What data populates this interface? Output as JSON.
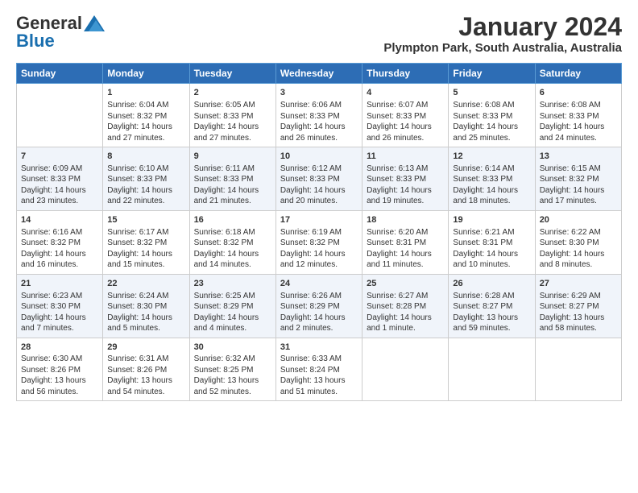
{
  "logo": {
    "general": "General",
    "blue": "Blue"
  },
  "title": "January 2024",
  "subtitle": "Plympton Park, South Australia, Australia",
  "days_of_week": [
    "Sunday",
    "Monday",
    "Tuesday",
    "Wednesday",
    "Thursday",
    "Friday",
    "Saturday"
  ],
  "weeks": [
    [
      {
        "day": "",
        "info": ""
      },
      {
        "day": "1",
        "info": "Sunrise: 6:04 AM\nSunset: 8:32 PM\nDaylight: 14 hours\nand 27 minutes."
      },
      {
        "day": "2",
        "info": "Sunrise: 6:05 AM\nSunset: 8:33 PM\nDaylight: 14 hours\nand 27 minutes."
      },
      {
        "day": "3",
        "info": "Sunrise: 6:06 AM\nSunset: 8:33 PM\nDaylight: 14 hours\nand 26 minutes."
      },
      {
        "day": "4",
        "info": "Sunrise: 6:07 AM\nSunset: 8:33 PM\nDaylight: 14 hours\nand 26 minutes."
      },
      {
        "day": "5",
        "info": "Sunrise: 6:08 AM\nSunset: 8:33 PM\nDaylight: 14 hours\nand 25 minutes."
      },
      {
        "day": "6",
        "info": "Sunrise: 6:08 AM\nSunset: 8:33 PM\nDaylight: 14 hours\nand 24 minutes."
      }
    ],
    [
      {
        "day": "7",
        "info": "Sunrise: 6:09 AM\nSunset: 8:33 PM\nDaylight: 14 hours\nand 23 minutes."
      },
      {
        "day": "8",
        "info": "Sunrise: 6:10 AM\nSunset: 8:33 PM\nDaylight: 14 hours\nand 22 minutes."
      },
      {
        "day": "9",
        "info": "Sunrise: 6:11 AM\nSunset: 8:33 PM\nDaylight: 14 hours\nand 21 minutes."
      },
      {
        "day": "10",
        "info": "Sunrise: 6:12 AM\nSunset: 8:33 PM\nDaylight: 14 hours\nand 20 minutes."
      },
      {
        "day": "11",
        "info": "Sunrise: 6:13 AM\nSunset: 8:33 PM\nDaylight: 14 hours\nand 19 minutes."
      },
      {
        "day": "12",
        "info": "Sunrise: 6:14 AM\nSunset: 8:33 PM\nDaylight: 14 hours\nand 18 minutes."
      },
      {
        "day": "13",
        "info": "Sunrise: 6:15 AM\nSunset: 8:32 PM\nDaylight: 14 hours\nand 17 minutes."
      }
    ],
    [
      {
        "day": "14",
        "info": "Sunrise: 6:16 AM\nSunset: 8:32 PM\nDaylight: 14 hours\nand 16 minutes."
      },
      {
        "day": "15",
        "info": "Sunrise: 6:17 AM\nSunset: 8:32 PM\nDaylight: 14 hours\nand 15 minutes."
      },
      {
        "day": "16",
        "info": "Sunrise: 6:18 AM\nSunset: 8:32 PM\nDaylight: 14 hours\nand 14 minutes."
      },
      {
        "day": "17",
        "info": "Sunrise: 6:19 AM\nSunset: 8:32 PM\nDaylight: 14 hours\nand 12 minutes."
      },
      {
        "day": "18",
        "info": "Sunrise: 6:20 AM\nSunset: 8:31 PM\nDaylight: 14 hours\nand 11 minutes."
      },
      {
        "day": "19",
        "info": "Sunrise: 6:21 AM\nSunset: 8:31 PM\nDaylight: 14 hours\nand 10 minutes."
      },
      {
        "day": "20",
        "info": "Sunrise: 6:22 AM\nSunset: 8:30 PM\nDaylight: 14 hours\nand 8 minutes."
      }
    ],
    [
      {
        "day": "21",
        "info": "Sunrise: 6:23 AM\nSunset: 8:30 PM\nDaylight: 14 hours\nand 7 minutes."
      },
      {
        "day": "22",
        "info": "Sunrise: 6:24 AM\nSunset: 8:30 PM\nDaylight: 14 hours\nand 5 minutes."
      },
      {
        "day": "23",
        "info": "Sunrise: 6:25 AM\nSunset: 8:29 PM\nDaylight: 14 hours\nand 4 minutes."
      },
      {
        "day": "24",
        "info": "Sunrise: 6:26 AM\nSunset: 8:29 PM\nDaylight: 14 hours\nand 2 minutes."
      },
      {
        "day": "25",
        "info": "Sunrise: 6:27 AM\nSunset: 8:28 PM\nDaylight: 14 hours\nand 1 minute."
      },
      {
        "day": "26",
        "info": "Sunrise: 6:28 AM\nSunset: 8:27 PM\nDaylight: 13 hours\nand 59 minutes."
      },
      {
        "day": "27",
        "info": "Sunrise: 6:29 AM\nSunset: 8:27 PM\nDaylight: 13 hours\nand 58 minutes."
      }
    ],
    [
      {
        "day": "28",
        "info": "Sunrise: 6:30 AM\nSunset: 8:26 PM\nDaylight: 13 hours\nand 56 minutes."
      },
      {
        "day": "29",
        "info": "Sunrise: 6:31 AM\nSunset: 8:26 PM\nDaylight: 13 hours\nand 54 minutes."
      },
      {
        "day": "30",
        "info": "Sunrise: 6:32 AM\nSunset: 8:25 PM\nDaylight: 13 hours\nand 52 minutes."
      },
      {
        "day": "31",
        "info": "Sunrise: 6:33 AM\nSunset: 8:24 PM\nDaylight: 13 hours\nand 51 minutes."
      },
      {
        "day": "",
        "info": ""
      },
      {
        "day": "",
        "info": ""
      },
      {
        "day": "",
        "info": ""
      }
    ]
  ]
}
